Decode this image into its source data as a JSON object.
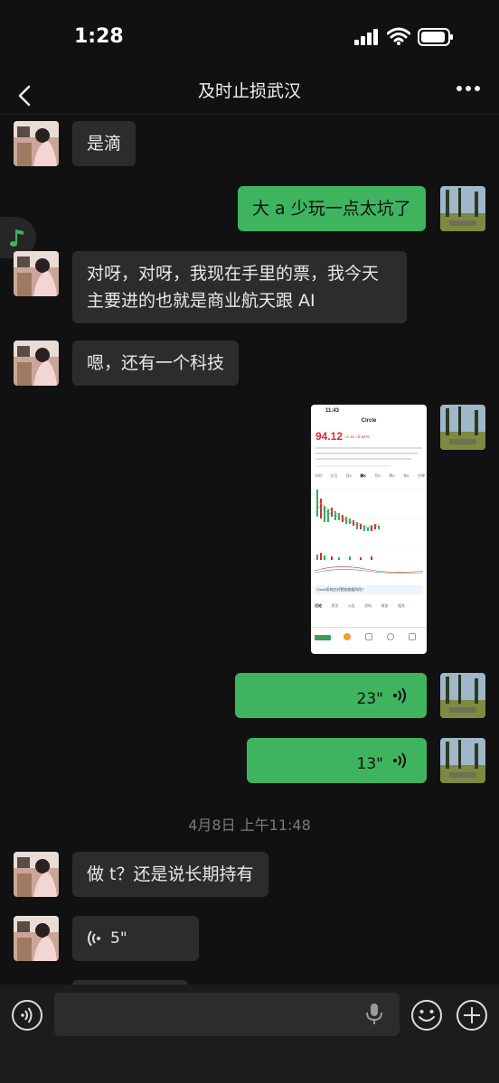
{
  "status": {
    "time": "1:28"
  },
  "header": {
    "title": "及时止损武汉"
  },
  "messages": {
    "m1": "是滴",
    "m2": "大 a 少玩一点太坑了",
    "m3": "对呀，对呀，我现在手里的票，我今天主要进的也就是商业航天跟 AI",
    "m4": "嗯，还有一个科技",
    "v1": "23\"",
    "v2": "13\"",
    "timestamp": "4月8日 上午11:48",
    "m5": "做 t？还是说长期持有",
    "v3": "5\""
  },
  "screenshot": {
    "time": "11:43",
    "name": "Circle",
    "price": "94.12",
    "change": "+1.11  +2.54%",
    "tabs": [
      "分时",
      "五日",
      "日K",
      "周K",
      "月K",
      "季K",
      "年K",
      "分钟"
    ],
    "banner": "Circle如何应对营收放缓风险?",
    "sub_tabs": [
      "讨论",
      "资讯",
      "公告",
      "资料",
      "财务",
      "相关"
    ]
  },
  "colors": {
    "bubble_out": "#3eb45f",
    "bubble_in": "#2c2c2c",
    "background": "#111111",
    "price_red": "#e0282e"
  }
}
